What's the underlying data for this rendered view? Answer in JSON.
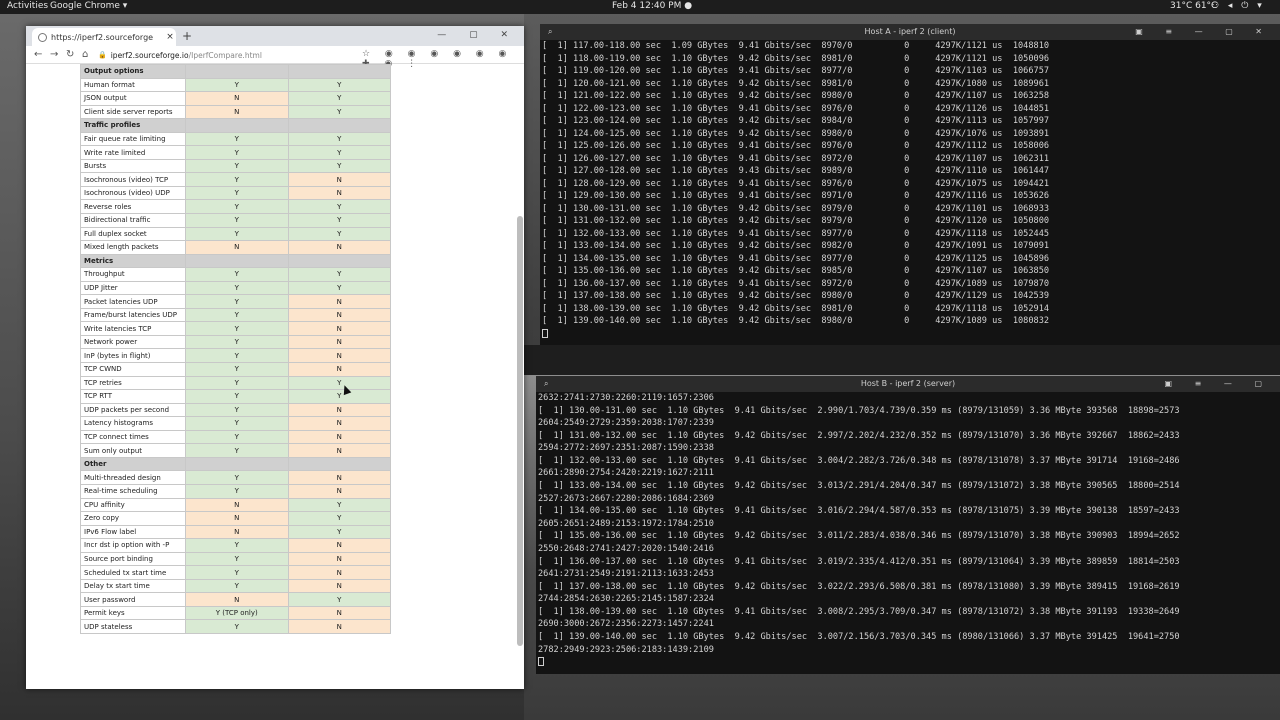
{
  "topbar": {
    "activities": "Activities",
    "app_name": "Google Chrome ▾",
    "clock": "Feb 4  12:40 PM ●",
    "temps": "31°C  61°C",
    "tray_icons": "⚇ ◂ ⏻ ▾"
  },
  "browser": {
    "tab_title": "https://iperf2.sourceforge",
    "tab_close": "×",
    "new_tab": "+",
    "window_controls": "— ▢ ✕",
    "nav": {
      "back": "←",
      "forward": "→",
      "reload": "↻",
      "home": "⌂"
    },
    "url_host": "iperf2.sourceforge.io",
    "url_path": "/IperfCompare.html",
    "lock_icon": "🔒",
    "extension_icons": "☆ ◉ ◉ ◉ ◉ ◉ ◉ ✚ ◉ ⋮"
  },
  "compare_table": {
    "rows": [
      {
        "type": "section",
        "label": "Output options"
      },
      {
        "type": "row",
        "label": "Human format",
        "a": "Y",
        "b": "Y"
      },
      {
        "type": "row",
        "label": "JSON output",
        "a": "N",
        "b": "Y"
      },
      {
        "type": "row",
        "label": "Client side server reports",
        "a": "N",
        "b": "Y"
      },
      {
        "type": "section",
        "label": "Traffic profiles"
      },
      {
        "type": "row",
        "label": "Fair queue rate limiting",
        "a": "Y",
        "b": "Y"
      },
      {
        "type": "row",
        "label": "Write rate limited",
        "a": "Y",
        "b": "Y"
      },
      {
        "type": "row",
        "label": "Bursts",
        "a": "Y",
        "b": "Y"
      },
      {
        "type": "row",
        "label": "Isochronous (video) TCP",
        "a": "Y",
        "b": "N"
      },
      {
        "type": "row",
        "label": "Isochronous (video) UDP",
        "a": "Y",
        "b": "N"
      },
      {
        "type": "row",
        "label": "Reverse roles",
        "a": "Y",
        "b": "Y"
      },
      {
        "type": "row",
        "label": "Bidirectional traffic",
        "a": "Y",
        "b": "Y"
      },
      {
        "type": "row",
        "label": "Full duplex socket",
        "a": "Y",
        "b": "Y"
      },
      {
        "type": "row",
        "label": "Mixed length packets",
        "a": "N",
        "b": "N"
      },
      {
        "type": "section",
        "label": "Metrics"
      },
      {
        "type": "row",
        "label": "Throughput",
        "a": "Y",
        "b": "Y"
      },
      {
        "type": "row",
        "label": "UDP Jitter",
        "a": "Y",
        "b": "Y"
      },
      {
        "type": "row",
        "label": "Packet latencies UDP",
        "a": "Y",
        "b": "N"
      },
      {
        "type": "row",
        "label": "Frame/burst latencies UDP",
        "a": "Y",
        "b": "N"
      },
      {
        "type": "row",
        "label": "Write latencies TCP",
        "a": "Y",
        "b": "N"
      },
      {
        "type": "row",
        "label": "Network power",
        "a": "Y",
        "b": "N"
      },
      {
        "type": "row",
        "label": "InP (bytes in flight)",
        "a": "Y",
        "b": "N"
      },
      {
        "type": "row",
        "label": "TCP CWND",
        "a": "Y",
        "b": "N"
      },
      {
        "type": "row",
        "label": "TCP retries",
        "a": "Y",
        "b": "Y"
      },
      {
        "type": "row",
        "label": "TCP RTT",
        "a": "Y",
        "b": "Y"
      },
      {
        "type": "row",
        "label": "UDP packets per second",
        "a": "Y",
        "b": "N"
      },
      {
        "type": "row",
        "label": "Latency histograms",
        "a": "Y",
        "b": "N"
      },
      {
        "type": "row",
        "label": "TCP connect times",
        "a": "Y",
        "b": "N"
      },
      {
        "type": "row",
        "label": "Sum only output",
        "a": "Y",
        "b": "N"
      },
      {
        "type": "section",
        "label": "Other"
      },
      {
        "type": "row",
        "label": "Multi-threaded design",
        "a": "Y",
        "b": "N"
      },
      {
        "type": "row",
        "label": "Real-time scheduling",
        "a": "Y",
        "b": "N"
      },
      {
        "type": "row",
        "label": "CPU affinity",
        "a": "N",
        "b": "Y"
      },
      {
        "type": "row",
        "label": "Zero copy",
        "a": "N",
        "b": "Y"
      },
      {
        "type": "row",
        "label": "IPv6 Flow label",
        "a": "N",
        "b": "Y"
      },
      {
        "type": "row",
        "label": "Incr dst ip option with -P",
        "a": "Y",
        "b": "N"
      },
      {
        "type": "row",
        "label": "Source port binding",
        "a": "Y",
        "b": "N"
      },
      {
        "type": "row",
        "label": "Scheduled tx start time",
        "a": "Y",
        "b": "N"
      },
      {
        "type": "row",
        "label": "Delay tx start time",
        "a": "Y",
        "b": "N"
      },
      {
        "type": "row",
        "label": "User password",
        "a": "N",
        "b": "Y"
      },
      {
        "type": "row",
        "label": "Permit keys",
        "a": "Y (TCP only)",
        "b": "N"
      },
      {
        "type": "row",
        "label": "UDP stateless",
        "a": "Y",
        "b": "N"
      }
    ]
  },
  "terminal_a": {
    "title": "Host A - iperf 2 (client)",
    "search_icon": "⌕",
    "controls": "▣ ≡ — ▢ ✕",
    "lines": [
      "[  1] 117.00-118.00 sec  1.09 GBytes  9.41 Gbits/sec  8970/0          0     4297K/1121 us  1048810",
      "[  1] 118.00-119.00 sec  1.10 GBytes  9.42 Gbits/sec  8981/0          0     4297K/1121 us  1050096",
      "[  1] 119.00-120.00 sec  1.10 GBytes  9.41 Gbits/sec  8977/0          0     4297K/1103 us  1066757",
      "[  1] 120.00-121.00 sec  1.10 GBytes  9.42 Gbits/sec  8981/0          0     4297K/1080 us  1089961",
      "[  1] 121.00-122.00 sec  1.10 GBytes  9.42 Gbits/sec  8980/0          0     4297K/1107 us  1063258",
      "[  1] 122.00-123.00 sec  1.10 GBytes  9.41 Gbits/sec  8976/0          0     4297K/1126 us  1044851",
      "[  1] 123.00-124.00 sec  1.10 GBytes  9.42 Gbits/sec  8984/0          0     4297K/1113 us  1057997",
      "[  1] 124.00-125.00 sec  1.10 GBytes  9.42 Gbits/sec  8980/0          0     4297K/1076 us  1093891",
      "[  1] 125.00-126.00 sec  1.10 GBytes  9.41 Gbits/sec  8976/0          0     4297K/1112 us  1058006",
      "[  1] 126.00-127.00 sec  1.10 GBytes  9.41 Gbits/sec  8972/0          0     4297K/1107 us  1062311",
      "[  1] 127.00-128.00 sec  1.10 GBytes  9.43 Gbits/sec  8989/0          0     4297K/1110 us  1061447",
      "[  1] 128.00-129.00 sec  1.10 GBytes  9.41 Gbits/sec  8976/0          0     4297K/1075 us  1094421",
      "[  1] 129.00-130.00 sec  1.10 GBytes  9.41 Gbits/sec  8971/0          0     4297K/1116 us  1053626",
      "[  1] 130.00-131.00 sec  1.10 GBytes  9.42 Gbits/sec  8979/0          0     4297K/1101 us  1068933",
      "[  1] 131.00-132.00 sec  1.10 GBytes  9.42 Gbits/sec  8979/0          0     4297K/1120 us  1050800",
      "[  1] 132.00-133.00 sec  1.10 GBytes  9.41 Gbits/sec  8977/0          0     4297K/1118 us  1052445",
      "[  1] 133.00-134.00 sec  1.10 GBytes  9.42 Gbits/sec  8982/0          0     4297K/1091 us  1079091",
      "[  1] 134.00-135.00 sec  1.10 GBytes  9.41 Gbits/sec  8977/0          0     4297K/1125 us  1045896",
      "[  1] 135.00-136.00 sec  1.10 GBytes  9.42 Gbits/sec  8985/0          0     4297K/1107 us  1063850",
      "[  1] 136.00-137.00 sec  1.10 GBytes  9.41 Gbits/sec  8972/0          0     4297K/1089 us  1079870",
      "[  1] 137.00-138.00 sec  1.10 GBytes  9.42 Gbits/sec  8980/0          0     4297K/1129 us  1042539",
      "[  1] 138.00-139.00 sec  1.10 GBytes  9.42 Gbits/sec  8981/0          0     4297K/1118 us  1052914",
      "[  1] 139.00-140.00 sec  1.10 GBytes  9.42 Gbits/sec  8980/0          0     4297K/1089 us  1080832"
    ]
  },
  "terminal_b": {
    "title": "Host B - iperf 2 (server)",
    "search_icon": "⌕",
    "controls": "▣ ≡ — ▢",
    "lines": [
      "2632:2741:2730:2260:2119:1657:2306",
      "[  1] 130.00-131.00 sec  1.10 GBytes  9.41 Gbits/sec  2.990/1.703/4.739/0.359 ms (8979/131059) 3.36 MByte 393568  18898=2573",
      "2604:2549:2729:2359:2038:1707:2339",
      "[  1] 131.00-132.00 sec  1.10 GBytes  9.42 Gbits/sec  2.997/2.202/4.232/0.352 ms (8979/131070) 3.36 MByte 392667  18862=2433",
      "2594:2772:2697:2351:2087:1590:2338",
      "[  1] 132.00-133.00 sec  1.10 GBytes  9.41 Gbits/sec  3.004/2.282/3.726/0.348 ms (8978/131078) 3.37 MByte 391714  19168=2486",
      "2661:2890:2754:2420:2219:1627:2111",
      "[  1] 133.00-134.00 sec  1.10 GBytes  9.42 Gbits/sec  3.013/2.291/4.204/0.347 ms (8979/131072) 3.38 MByte 390565  18800=2514",
      "2527:2673:2667:2280:2086:1684:2369",
      "[  1] 134.00-135.00 sec  1.10 GBytes  9.41 Gbits/sec  3.016/2.294/4.587/0.353 ms (8978/131075) 3.39 MByte 390138  18597=2433",
      "2605:2651:2489:2153:1972:1784:2510",
      "[  1] 135.00-136.00 sec  1.10 GBytes  9.42 Gbits/sec  3.011/2.283/4.038/0.346 ms (8979/131070) 3.38 MByte 390903  18994=2652",
      "2550:2648:2741:2427:2020:1540:2416",
      "[  1] 136.00-137.00 sec  1.10 GBytes  9.41 Gbits/sec  3.019/2.335/4.412/0.351 ms (8979/131064) 3.39 MByte 389859  18814=2503",
      "2641:2731:2549:2191:2113:1633:2453",
      "[  1] 137.00-138.00 sec  1.10 GBytes  9.42 Gbits/sec  3.022/2.293/6.508/0.381 ms (8978/131080) 3.39 MByte 389415  19168=2619",
      "2744:2854:2630:2265:2145:1587:2324",
      "[  1] 138.00-139.00 sec  1.10 GBytes  9.41 Gbits/sec  3.008/2.295/3.709/0.347 ms (8978/131072) 3.38 MByte 391193  19338=2649",
      "2690:3000:2672:2356:2273:1457:2241",
      "[  1] 139.00-140.00 sec  1.10 GBytes  9.42 Gbits/sec  3.007/2.156/3.703/0.345 ms (8980/131066) 3.37 MByte 391425  19641=2750",
      "2782:2949:2923:2506:2183:1439:2109"
    ]
  },
  "colors": {
    "yes_cell": "#d9ead3",
    "no_cell": "#fce5cd",
    "section_row": "#d0d0d0",
    "terminal_bg": "#131313"
  }
}
